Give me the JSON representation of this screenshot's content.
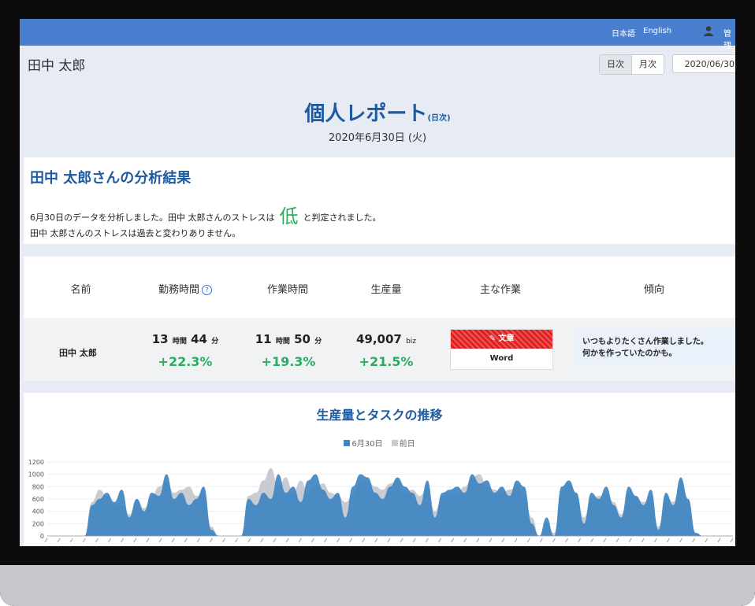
{
  "header": {
    "lang_ja": "日本語",
    "lang_en": "English",
    "admin": "管理",
    "accent": "#4a7fcf"
  },
  "user": {
    "name": "田中 太郎"
  },
  "controls": {
    "daily": "日次",
    "monthly": "月次",
    "date": "2020/06/30"
  },
  "report": {
    "title": "個人レポート",
    "title_suffix": "(日次)",
    "date": "2020年6月30日 (火)"
  },
  "analysis": {
    "title": "田中 太郎さんの分析結果",
    "line1_before": "6月30日のデータを分析しました。田中 太郎さんのストレスは",
    "level": "低",
    "line1_after": "と判定されました。",
    "line2": "田中 太郎さんのストレスは過去と変わりありません。"
  },
  "table": {
    "headers": {
      "name": "名前",
      "work_time": "勤務時間",
      "task_time": "作業時間",
      "productivity": "生産量",
      "main_task": "主な作業",
      "trend": "傾向"
    },
    "row": {
      "name": "田中 太郎",
      "work_time": {
        "hours": "13",
        "hours_unit": "時間",
        "minutes": "44",
        "minutes_unit": "分",
        "delta": "+22.3%"
      },
      "task_time": {
        "hours": "11",
        "hours_unit": "時間",
        "minutes": "50",
        "minutes_unit": "分",
        "delta": "+19.3%"
      },
      "productivity": {
        "value": "49,007",
        "unit": "biz",
        "delta": "+21.5%"
      },
      "main_task": {
        "category": "文章",
        "app": "Word",
        "color": "#e02020"
      },
      "trend": {
        "line1": "いつもよりたくさん作業しました。",
        "line2": "何かを作っていたのかも。"
      }
    }
  },
  "chart": {
    "title": "生産量とタスクの推移",
    "legend_today": "6月30日",
    "legend_prev": "前日"
  },
  "chart_data": {
    "type": "area",
    "title": "生産量とタスクの推移",
    "ylim": [
      0,
      1200
    ],
    "yticks": [
      0,
      200,
      400,
      600,
      800,
      1000,
      1200
    ],
    "series": [
      {
        "name": "6月30日",
        "color": "#3f86c2",
        "values": [
          0,
          0,
          0,
          0,
          0,
          0,
          500,
          600,
          700,
          550,
          750,
          300,
          600,
          400,
          700,
          650,
          1000,
          600,
          700,
          500,
          600,
          800,
          100,
          0,
          0,
          0,
          0,
          600,
          500,
          700,
          600,
          1000,
          700,
          800,
          550,
          900,
          1000,
          750,
          600,
          700,
          300,
          800,
          1000,
          950,
          700,
          600,
          800,
          950,
          800,
          700,
          500,
          900,
          300,
          700,
          750,
          800,
          700,
          1000,
          850,
          900,
          700,
          800,
          650,
          900,
          800,
          200,
          0,
          300,
          0,
          800,
          900,
          700,
          200,
          700,
          600,
          800,
          500,
          300,
          800,
          650,
          500,
          750,
          100,
          700,
          500,
          950,
          600,
          50,
          0,
          0,
          0,
          0,
          0
        ]
      },
      {
        "name": "前日",
        "color": "#c8cbd2",
        "values": [
          0,
          0,
          0,
          0,
          0,
          0,
          550,
          750,
          650,
          500,
          500,
          350,
          600,
          450,
          650,
          800,
          900,
          700,
          750,
          800,
          650,
          700,
          150,
          0,
          0,
          0,
          0,
          650,
          700,
          900,
          1100,
          800,
          950,
          700,
          900,
          700,
          800,
          850,
          700,
          650,
          550,
          650,
          900,
          900,
          800,
          750,
          850,
          900,
          700,
          750,
          650,
          800,
          400,
          650,
          700,
          700,
          800,
          950,
          1000,
          800,
          750,
          700,
          750,
          800,
          650,
          300,
          0,
          200,
          50,
          700,
          850,
          650,
          300,
          600,
          650,
          700,
          550,
          350,
          700,
          600,
          550,
          650,
          150,
          650,
          550,
          900,
          550,
          50,
          0,
          0,
          0,
          0,
          0
        ]
      }
    ]
  }
}
